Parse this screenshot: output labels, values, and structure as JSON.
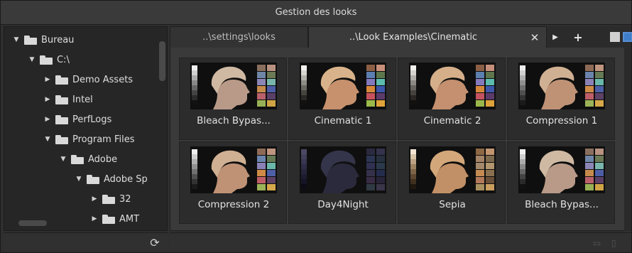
{
  "window": {
    "title": "Gestion des looks"
  },
  "tree": [
    {
      "label": "Bureau",
      "expanded": true,
      "depth": 0
    },
    {
      "label": "C:\\",
      "expanded": true,
      "depth": 1
    },
    {
      "label": "Demo Assets",
      "expanded": false,
      "depth": 2
    },
    {
      "label": "Intel",
      "expanded": false,
      "depth": 2
    },
    {
      "label": "PerfLogs",
      "expanded": false,
      "depth": 2
    },
    {
      "label": "Program Files",
      "expanded": true,
      "depth": 2
    },
    {
      "label": "Adobe",
      "expanded": true,
      "depth": 3
    },
    {
      "label": "Adobe Sp",
      "expanded": true,
      "depth": 4
    },
    {
      "label": "32",
      "expanded": false,
      "depth": 5
    },
    {
      "label": "AMT",
      "expanded": false,
      "depth": 5
    }
  ],
  "tabs": [
    {
      "label": "..\\settings\\looks",
      "active": false
    },
    {
      "label": "..\\Look Examples\\Cinematic",
      "active": true
    }
  ],
  "tab_controls": {
    "close": "✕",
    "next": "▶",
    "add": "+"
  },
  "sidebar_footer": {
    "refresh": "⟳"
  },
  "looks": [
    {
      "name": "Bleach Bypas...",
      "tint": "bleach"
    },
    {
      "name": "Cinematic 1",
      "tint": "cinematic1"
    },
    {
      "name": "Cinematic 2",
      "tint": "cinematic2"
    },
    {
      "name": "Compression 1",
      "tint": "compression1"
    },
    {
      "name": "Compression 2",
      "tint": "compression2"
    },
    {
      "name": "Day4Night",
      "tint": "day4night"
    },
    {
      "name": "Sepia",
      "tint": "sepia"
    },
    {
      "name": "Bleach Bypas...",
      "tint": "bleach"
    }
  ],
  "tints": {
    "bleach": {
      "skin": "#b99a88",
      "hair": "#cfb9a3",
      "gray": [
        "#f0f0f0",
        "#cfcfcf",
        "#ababab",
        "#888",
        "#666",
        "#444",
        "#2a2a2a",
        "#111"
      ],
      "chart": [
        "#8a6e5e",
        "#b89280",
        "#6f86a6",
        "#6b7a55",
        "#8b86b6",
        "#79b7ad",
        "#c58b4c",
        "#4d5ea7",
        "#b9606b",
        "#5a3f66",
        "#98b055",
        "#d0a445",
        "#3f4f92",
        "#5f8f55",
        "#a34446",
        "#d8c04d",
        "#a95e96",
        "#3d7ea6",
        "#f0f0f0",
        "#999"
      ]
    },
    "cinematic1": {
      "skin": "#c7916d",
      "hair": "#d8b28a",
      "gray": [
        "#f5f2ee",
        "#d8d4cf",
        "#b3afaa",
        "#8e8a85",
        "#6a6661",
        "#47433f",
        "#2a2724",
        "#121110"
      ],
      "chart": [
        "#8c5f44",
        "#c8907a",
        "#5b7fb0",
        "#5c774c",
        "#8379bd",
        "#5bbcaf",
        "#d7873a",
        "#3c56ab",
        "#c7525e",
        "#5c3a6a",
        "#9bba48",
        "#e0a33a",
        "#2f43a0",
        "#4a944e",
        "#b3373b",
        "#ecc940",
        "#ba569c",
        "#2a86b7",
        "#f7f7f7",
        "#a0a0a0"
      ]
    },
    "cinematic2": {
      "skin": "#c4906f",
      "hair": "#d5af8a",
      "gray": [
        "#f3f1ee",
        "#d6d3cf",
        "#b1ada9",
        "#8c8884",
        "#67635f",
        "#45413e",
        "#292624",
        "#121110"
      ],
      "chart": [
        "#8a5f46",
        "#c58f7a",
        "#5c80ae",
        "#5d764d",
        "#8479bb",
        "#5dbbae",
        "#d4863b",
        "#3e57a9",
        "#c4535f",
        "#5c3b69",
        "#9ab849",
        "#dea23b",
        "#3144a0",
        "#4b924f",
        "#b1383c",
        "#e9c841",
        "#b8579b",
        "#2c85b5",
        "#f5f5f5",
        "#a0a0a0"
      ]
    },
    "compression1": {
      "skin": "#bf9276",
      "hair": "#d0b092",
      "gray": [
        "#eeeeee",
        "#d0d0d0",
        "#b0b0b0",
        "#909090",
        "#707070",
        "#505050",
        "#333",
        "#1a1a1a"
      ],
      "chart": [
        "#8e6a56",
        "#c09580",
        "#6a84ac",
        "#667a55",
        "#8a82b6",
        "#6ab7ab",
        "#ce8b47",
        "#4d5fa6",
        "#bf5e68",
        "#5d4266",
        "#9cb358",
        "#d6a84a",
        "#40509a",
        "#5a9058",
        "#ab4548",
        "#dfc34e",
        "#ae5e98",
        "#3f82aa",
        "#efefef",
        "#a6a6a6"
      ]
    },
    "compression2": {
      "skin": "#bf9276",
      "hair": "#d0b092",
      "gray": [
        "#eeeeee",
        "#d0d0d0",
        "#b0b0b0",
        "#909090",
        "#707070",
        "#505050",
        "#333",
        "#1a1a1a"
      ],
      "chart": [
        "#8e6a56",
        "#c09580",
        "#6a84ac",
        "#667a55",
        "#8a82b6",
        "#6ab7ab",
        "#ce8b47",
        "#4d5fa6",
        "#bf5e68",
        "#5d4266",
        "#9cb358",
        "#d6a84a",
        "#40509a",
        "#5a9058",
        "#ab4548",
        "#dfc34e",
        "#ae5e98",
        "#3f82aa",
        "#efefef",
        "#a6a6a6"
      ]
    },
    "day4night": {
      "skin": "#2a2a3c",
      "hair": "#34344a",
      "gray": [
        "#4a4a62",
        "#40405a",
        "#363650",
        "#2c2c45",
        "#24243b",
        "#1c1c30",
        "#141425",
        "#0c0c18"
      ],
      "chart": [
        "#2a2a40",
        "#33334d",
        "#2b3552",
        "#26303e",
        "#303052",
        "#2a3a4c",
        "#36314a",
        "#232c4c",
        "#382c45",
        "#28243a",
        "#2f3a44",
        "#3a3548",
        "#212a48",
        "#263644",
        "#382a40",
        "#3d3a4a",
        "#352c48",
        "#223448",
        "#4a4a62",
        "#2e2e44"
      ]
    },
    "sepia": {
      "skin": "#c29066",
      "hair": "#d3a77a",
      "gray": [
        "#f2e5d4",
        "#d8c4a8",
        "#bba282",
        "#9d8262",
        "#7e6448",
        "#5f4832",
        "#40301f",
        "#201810"
      ],
      "chart": [
        "#8c6844",
        "#c49670",
        "#a48466",
        "#7e6a4c",
        "#a4886c",
        "#b2966e",
        "#c48a52",
        "#8a704e",
        "#b27a5a",
        "#6a5038",
        "#a89060",
        "#ca9e5e",
        "#7a6448",
        "#8a7856",
        "#a2644a",
        "#d0aa64",
        "#a87a66",
        "#8a7a66",
        "#f2e5d4",
        "#b09c84"
      ]
    }
  }
}
